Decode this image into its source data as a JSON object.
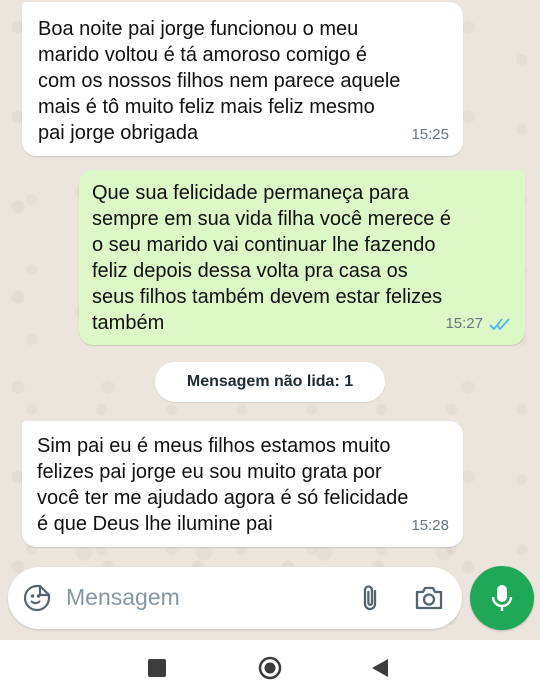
{
  "messages": [
    {
      "direction": "incoming",
      "text": "Boa noite pai jorge funcionou o meu\nmarido voltou é tá amoroso comigo é\ncom os nossos filhos nem parece aquele\nmais é tô muito feliz mais feliz mesmo\npai jorge obrigada",
      "time": "15:25"
    },
    {
      "direction": "outgoing",
      "text": "Que sua felicidade permaneça para\nsempre em sua vida filha você merece é\no seu marido vai continuar lhe fazendo\nfeliz depois dessa volta pra casa os\nseus filhos também devem estar felizes\ntambém",
      "time": "15:27",
      "status": "read"
    },
    {
      "direction": "incoming",
      "text": "Sim pai eu é  meus filhos estamos muito\nfelizes pai jorge eu sou muito grata por\nvocê ter me ajudado agora é só felicidade\né  que Deus lhe ilumine pai",
      "time": "15:28"
    }
  ],
  "unread_label": "Mensagem não lida: 1",
  "composer": {
    "placeholder": "Mensagem",
    "icons": [
      "sticker-emoji-icon",
      "paperclip-icon",
      "camera-icon"
    ]
  },
  "mic_icon": "microphone-icon",
  "nav_icons": [
    "recents-square-icon",
    "home-circle-icon",
    "back-triangle-icon"
  ],
  "colors": {
    "incoming_bubble": "#ffffff",
    "outgoing_bubble": "#dcf8c6",
    "accent_green": "#1fa855",
    "read_ticks": "#4fb6ec"
  }
}
